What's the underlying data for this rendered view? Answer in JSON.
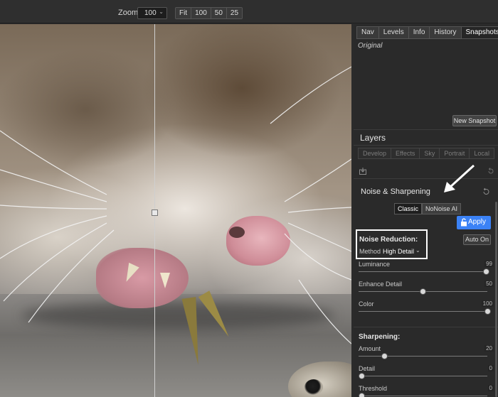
{
  "toolbar": {
    "zoom_label": "Zoom",
    "zoom_value": "100",
    "zoom_buttons": [
      "Fit",
      "100",
      "50",
      "25"
    ]
  },
  "panel": {
    "tabs": [
      "Nav",
      "Levels",
      "Info",
      "History",
      "Snapshots"
    ],
    "active_tab": "Snapshots",
    "snapshot_original": "Original",
    "new_snapshot_label": "New Snapshot",
    "layers_title": "Layers",
    "modules": [
      "Develop",
      "Effects",
      "Sky",
      "Portrait",
      "Local"
    ],
    "section_title": "Noise & Sharpening",
    "mode_buttons": [
      "Classic",
      "NoNoise AI"
    ],
    "active_mode": "Classic",
    "apply_label": "Apply",
    "noise_reduction": {
      "label": "Noise Reduction:",
      "auto_on_label": "Auto On",
      "method_label": "Method",
      "method_value": "High Detail",
      "sliders": [
        {
          "label": "Luminance",
          "value": 99,
          "max": 100
        },
        {
          "label": "Enhance Detail",
          "value": 50,
          "max": 100
        },
        {
          "label": "Color",
          "value": 100,
          "max": 100
        }
      ]
    },
    "sharpening": {
      "label": "Sharpening:",
      "sliders": [
        {
          "label": "Amount",
          "value": 20,
          "max": 100
        },
        {
          "label": "Detail",
          "value": 0,
          "max": 100
        },
        {
          "label": "Threshold",
          "value": 0,
          "max": 100
        }
      ]
    }
  },
  "colors": {
    "accent": "#3b82f6",
    "panel_bg": "#2a2a2a",
    "callout": "#ffffff"
  }
}
